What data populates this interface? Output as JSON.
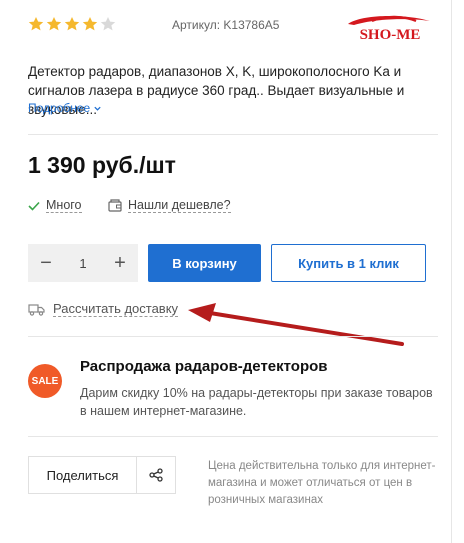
{
  "rating": {
    "value": 4,
    "max": 5,
    "filled_color": "#f5b82e",
    "empty_color": "#d9d9d9"
  },
  "article": {
    "text": "Артикул: K13786A5"
  },
  "brand": {
    "logo_text": "SHO-ME",
    "color": "#d4181e"
  },
  "description": {
    "text": "Детектор радаров, диапазонов X, K, широкополосного Ka и сигналов лазера в радиусе 360 град.. Выдает визуальные и звуковые...",
    "more_label": "Подробнее"
  },
  "price": {
    "text": "1 390 руб./шт"
  },
  "availability": {
    "stock_label": "Много",
    "cheaper_label": "Нашли дешевле?"
  },
  "purchase": {
    "quantity": "1",
    "minus": "−",
    "plus": "+",
    "cart_label": "В корзину",
    "one_click_label": "Купить в 1 клик",
    "accent_color": "#1f6fd1"
  },
  "delivery": {
    "label": "Рассчитать доставку"
  },
  "promo": {
    "badge": "SALE",
    "badge_color": "#f05a28",
    "title": "Распродажа радаров-детекторов",
    "text": "Дарим скидку 10% на радары-детекторы при заказе товаров в нашем интернет-магазине."
  },
  "share": {
    "label": "Поделиться",
    "icon": "share-icon"
  },
  "price_note": {
    "text": "Цена действительна только для интернет-магазина и может отличаться от цен в розничных магазинах"
  },
  "annotation": {
    "arrow_color": "#b51c1c"
  }
}
